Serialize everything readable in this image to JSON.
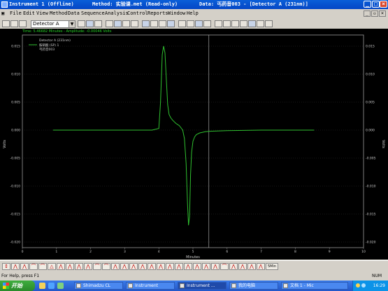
{
  "window": {
    "title_app": "Instrument 1 (Offline)",
    "title_method": "Method: 实验课.met (Read-only)",
    "title_data": "Data: 丐药音003 - [Detector A (231nm)]"
  },
  "menu": [
    "File",
    "Edit",
    "View",
    "Method",
    "Data",
    "Sequence",
    "Analysis",
    "Control",
    "Reports",
    "Window",
    "Help"
  ],
  "toolbar": {
    "detector_select": "Detector A"
  },
  "chart_info": "Time: 5.46682 Minutes - Amplitude: -0.00046 Volts",
  "legend": {
    "title": "Detector A (231nm)",
    "entry1": "胺硝酸 (SP) 1",
    "entry2": "丐药音003"
  },
  "chart_data": {
    "type": "line",
    "xlabel": "Minutes",
    "ylabel": "Volts",
    "y2label": "Volts",
    "xlim": [
      0,
      10
    ],
    "ylim": [
      -0.021,
      0.017
    ],
    "x_ticks": [
      0,
      1,
      2,
      3,
      4,
      5,
      6,
      7,
      8,
      9,
      10
    ],
    "y_ticks": [
      0.015,
      0.01,
      0.005,
      0.0,
      -0.005,
      -0.01,
      -0.015,
      -0.02
    ],
    "y_tick_labels": [
      "0.015",
      "0.010",
      "0.005",
      "0.000",
      "-0.005",
      "-0.010",
      "-0.015",
      "-0.020"
    ],
    "cursor_x": 5.46682,
    "series": [
      {
        "name": "胺硝酸 (SP) 1",
        "color": "#2fc02f",
        "x": [
          0.9,
          2.0,
          3.0,
          3.8,
          4.0,
          4.05,
          4.1,
          4.14,
          4.18,
          4.22,
          4.26,
          4.3,
          4.35,
          4.4,
          4.5,
          4.6,
          4.7,
          4.75,
          4.8,
          4.84,
          4.87,
          4.9,
          4.93,
          4.96,
          5.0,
          5.05,
          5.1,
          5.2,
          5.35,
          5.5,
          6.0,
          7.0,
          8.0,
          8.55
        ],
        "y": [
          0.0,
          0.0,
          0.0,
          0.0,
          0.0003,
          0.005,
          0.0135,
          0.015,
          0.0138,
          0.009,
          0.0045,
          0.0028,
          0.0022,
          0.0018,
          0.0012,
          0.0008,
          0.0,
          -0.0015,
          -0.006,
          -0.013,
          -0.017,
          -0.0155,
          -0.008,
          -0.004,
          -0.002,
          -0.0012,
          -0.0008,
          -0.0005,
          -0.0003,
          -0.0002,
          -0.0001,
          0.0,
          0.0,
          0.0
        ]
      }
    ]
  },
  "bottom_toolbar": {
    "label": "5Min"
  },
  "status": {
    "help": "For Help, press F1",
    "mode": "NUM"
  },
  "taskbar": {
    "start": "开始",
    "tasks": [
      "Shimadzu CL",
      "Instrument",
      "Instrument ...",
      "我的电脑",
      "文档 1 - Mic"
    ],
    "clock": "16:29"
  },
  "colors": {
    "title_bg": "#0a5fd8",
    "chart_bg": "#000000",
    "trace": "#2fc02f",
    "axis": "#cfcfcf"
  }
}
